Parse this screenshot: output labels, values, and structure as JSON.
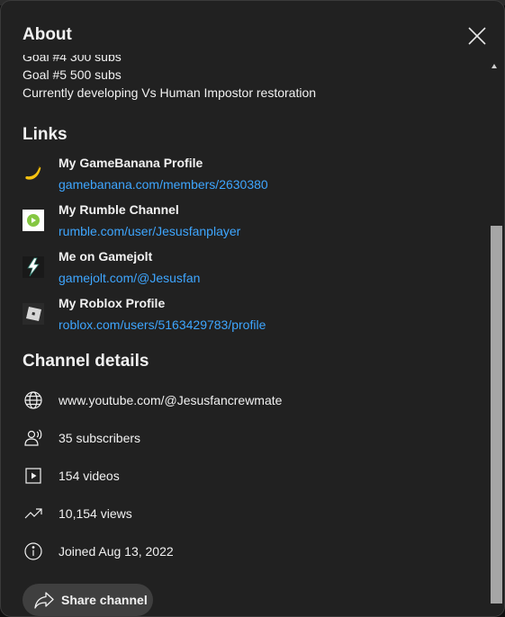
{
  "dialog": {
    "title": "About",
    "close_icon": "close-icon"
  },
  "description": {
    "lines": [
      "Goal #4 300 subs",
      "Goal #5 500 subs",
      "Currently developing Vs Human Impostor restoration"
    ]
  },
  "links": {
    "heading": "Links",
    "items": [
      {
        "title": "My GameBanana Profile",
        "url": "gamebanana.com/members/2630380",
        "icon": "gamebanana-icon"
      },
      {
        "title": "My Rumble Channel",
        "url": "rumble.com/user/Jesusfanplayer",
        "icon": "rumble-icon"
      },
      {
        "title": "Me on Gamejolt",
        "url": "gamejolt.com/@Jesusfan",
        "icon": "gamejolt-icon"
      },
      {
        "title": "My Roblox Profile",
        "url": "roblox.com/users/5163429783/profile",
        "icon": "roblox-icon"
      }
    ]
  },
  "channel_details": {
    "heading": "Channel details",
    "rows": [
      {
        "text": "www.youtube.com/@Jesusfancrewmate",
        "icon": "globe-icon"
      },
      {
        "text": "35 subscribers",
        "icon": "subscribers-icon"
      },
      {
        "text": "154 videos",
        "icon": "videos-icon"
      },
      {
        "text": "10,154 views",
        "icon": "trending-icon"
      },
      {
        "text": "Joined Aug 13, 2022",
        "icon": "info-icon"
      }
    ]
  },
  "share": {
    "label": "Share channel",
    "icon": "share-icon"
  },
  "colors": {
    "background": "#212121",
    "text": "#f1f1f1",
    "link": "#3ea6ff",
    "button": "#3f3f3f"
  }
}
